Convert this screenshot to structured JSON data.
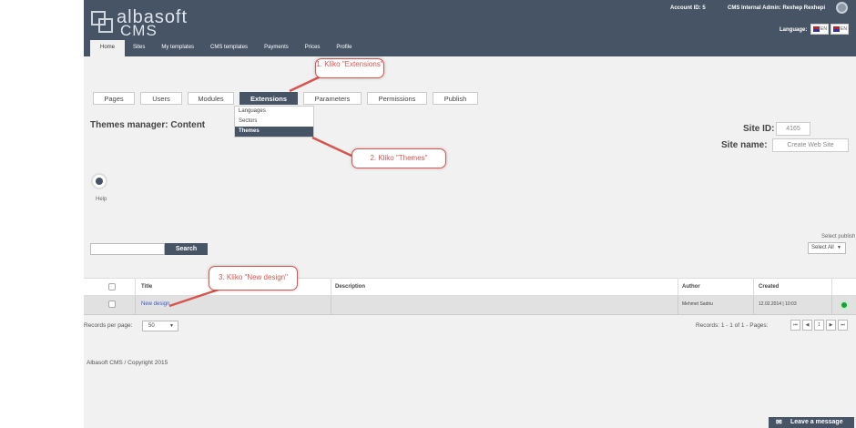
{
  "header": {
    "logo_line1": "albasoft",
    "logo_line2": "CMS",
    "account_id": "Account ID: 5",
    "admin_name": "CMS Internal Admin: Rexhep Rexhepi",
    "language_label": "Language:",
    "language_flags": [
      "EN",
      "EN"
    ]
  },
  "nav": {
    "items": [
      {
        "label": "Home"
      },
      {
        "label": "Sites"
      },
      {
        "label": "My templates"
      },
      {
        "label": "CMS templates"
      },
      {
        "label": "Payments"
      },
      {
        "label": "Prices"
      },
      {
        "label": "Profile"
      }
    ]
  },
  "tabs": [
    {
      "label": "Pages"
    },
    {
      "label": "Users"
    },
    {
      "label": "Modules"
    },
    {
      "label": "Extensions"
    },
    {
      "label": "Parameters"
    },
    {
      "label": "Permissions"
    },
    {
      "label": "Publish"
    }
  ],
  "extensions_menu": {
    "items": [
      {
        "label": "Languages"
      },
      {
        "label": "Sectors"
      },
      {
        "label": "Themes"
      }
    ]
  },
  "page_title": "Themes manager: Content",
  "site": {
    "id_label": "Site ID:",
    "id_value": "4165",
    "name_label": "Site name:",
    "name_value": "Create Web Site"
  },
  "help_label": "Help",
  "search": {
    "button_label": "Search",
    "value": ""
  },
  "select_publish": {
    "label": "Select publish",
    "value": "Select All"
  },
  "table": {
    "headers": {
      "title": "Title",
      "description": "Description",
      "author": "Author",
      "created": "Created"
    },
    "rows": [
      {
        "title": "New design",
        "description": "",
        "author": "Mehmet Sadriu",
        "created": "12.02.2014 | 10:03"
      }
    ]
  },
  "paging": {
    "records_per_page_label": "Records per page:",
    "records_per_page": "50",
    "records_info": "Records: 1 - 1 of 1 - Pages:",
    "current_page": "1"
  },
  "footer": {
    "copyright": "Albasoft CMS / Copyright 2015"
  },
  "chat": {
    "label": "Leave a message"
  },
  "annotations": {
    "step1": "1. Kliko \"Extensions\"",
    "step2": "2. Kliko \"Themes\"",
    "step3": "3. Kliko \"New design\""
  },
  "colors": {
    "brand": "#475466",
    "annotation": "#d9534f",
    "status_active": "#1e9b3a"
  }
}
